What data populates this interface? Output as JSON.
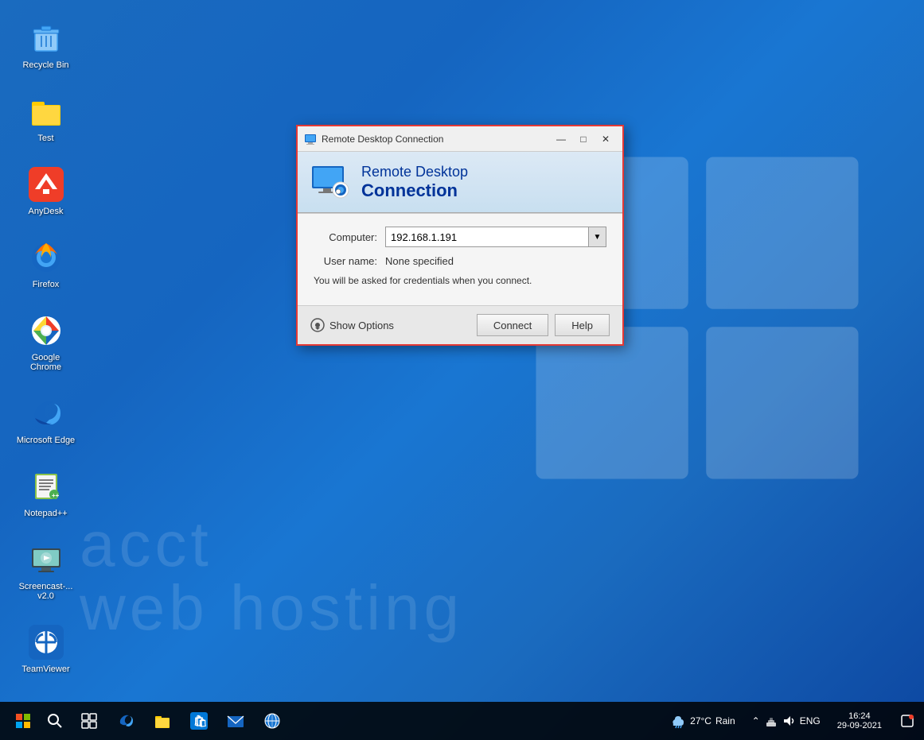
{
  "desktop": {
    "background_colors": [
      "#1565c0",
      "#1976d2"
    ],
    "watermark_line1": "acct",
    "watermark_line2": "web hosting"
  },
  "icons": [
    {
      "id": "recycle-bin",
      "label": "Recycle Bin",
      "icon": "recycle"
    },
    {
      "id": "test",
      "label": "Test",
      "icon": "folder"
    },
    {
      "id": "anydesk",
      "label": "AnyDesk",
      "icon": "anydesk"
    },
    {
      "id": "firefox",
      "label": "Firefox",
      "icon": "firefox"
    },
    {
      "id": "google-chrome",
      "label": "Google Chrome",
      "icon": "chrome"
    },
    {
      "id": "microsoft-edge",
      "label": "Microsoft Edge",
      "icon": "edge"
    },
    {
      "id": "notepadpp",
      "label": "Notepad++",
      "icon": "notepadpp"
    },
    {
      "id": "screencast",
      "label": "Screencast-... v2.0",
      "icon": "screencast"
    },
    {
      "id": "teamviewer",
      "label": "TeamViewer",
      "icon": "teamviewer"
    }
  ],
  "rdc_dialog": {
    "title_bar": "Remote Desktop Connection",
    "header_line1": "Remote Desktop",
    "header_line2": "Connection",
    "computer_label": "Computer:",
    "computer_value": "192.168.1.191",
    "username_label": "User name:",
    "username_value": "None specified",
    "info_text": "You will be asked for credentials when you connect.",
    "show_options_label": "Show Options",
    "connect_label": "Connect",
    "help_label": "Help"
  },
  "taskbar": {
    "weather_temp": "27°C",
    "weather_condition": "Rain",
    "language": "ENG",
    "time": "16:24",
    "date": "29-09-2021"
  }
}
